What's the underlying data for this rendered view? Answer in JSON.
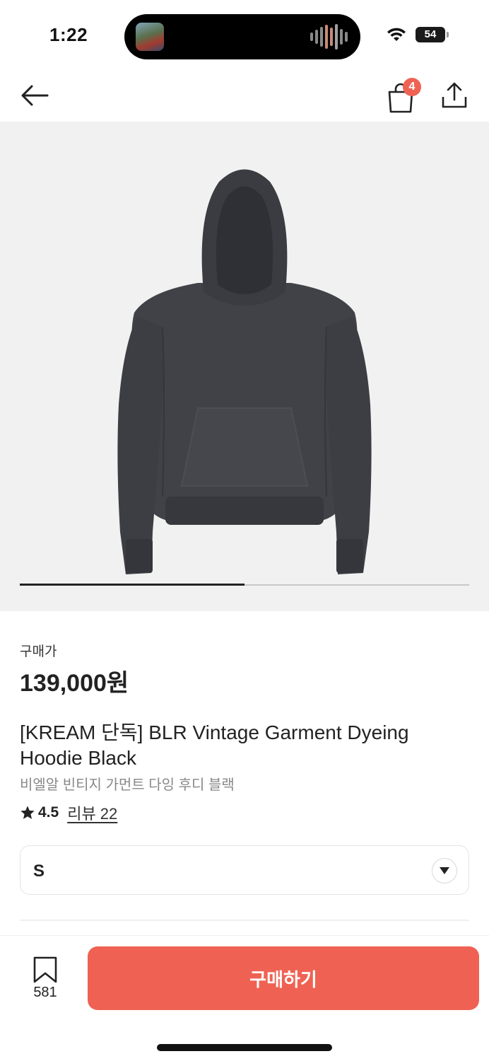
{
  "status_bar": {
    "time": "1:22",
    "battery": "54",
    "icons": [
      "wifi-icon",
      "battery-icon"
    ]
  },
  "nav": {
    "back_icon": "arrow-left-icon",
    "bag_icon": "shopping-bag-icon",
    "bag_badge": "4",
    "share_icon": "share-icon"
  },
  "gallery": {
    "progress": 0.5
  },
  "product": {
    "price_label": "구매가",
    "price": "139,000원",
    "title": "[KREAM 단독] BLR Vintage Garment Dyeing Hoodie Black",
    "subtitle": "비엘알 빈티지 가먼트 다잉 후디 블랙",
    "rating": "4.5",
    "review_link": "리뷰 22"
  },
  "size_select": {
    "value": "S"
  },
  "bottom_bar": {
    "wishlist_count": "581",
    "buy_label": "구매하기"
  },
  "colors": {
    "accent": "#ef6253",
    "image_bg": "#f1f1f1",
    "hoodie": "#3f4146"
  }
}
